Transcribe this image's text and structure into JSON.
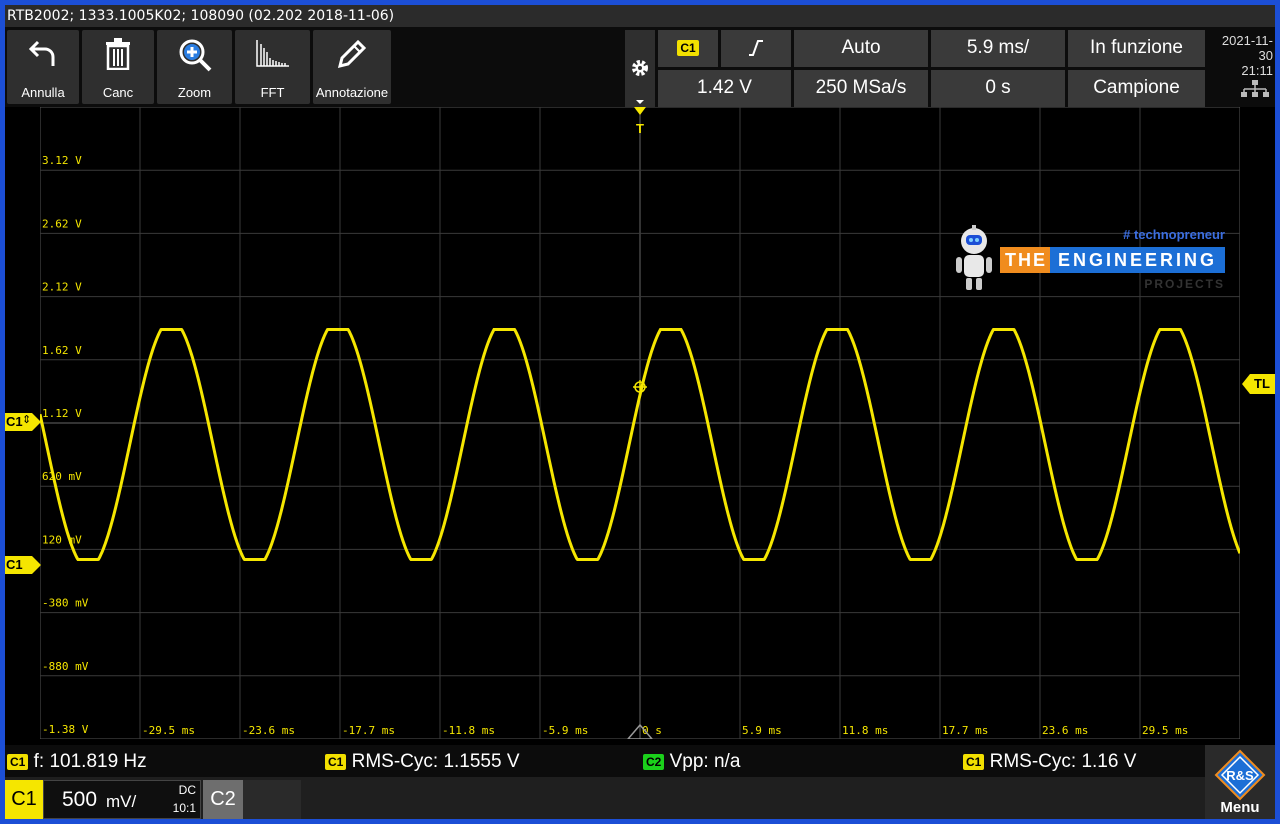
{
  "title": "RTB2002; 1333.1005K02; 108090 (02.202 2018-11-06)",
  "toolbar": {
    "undo": "Annulla",
    "delete": "Canc",
    "zoom": "Zoom",
    "fft": "FFT",
    "annotation": "Annotazione"
  },
  "trigger": {
    "source": "C1",
    "slope_icon": "rising-edge-icon",
    "mode": "Auto",
    "timebase": "5.9 ms/",
    "run_state": "In funzione",
    "level": "1.42 V",
    "sample_rate": "250 MSa/s",
    "position": "0 s",
    "acquisition": "Campione"
  },
  "datetime": {
    "date": "2021-11-30",
    "time": "21:11"
  },
  "watermark": {
    "tag": "# technopreneur",
    "word1": "THE",
    "word2": "ENGINEERING",
    "word3": "PROJECTS"
  },
  "markers": {
    "trigger_top": "T",
    "trigger_level": "TL",
    "channel_offset": "C1",
    "channel_ground": "C1"
  },
  "colors": {
    "trace": "#f5e600",
    "grid": "#3a3a3a",
    "accent_blue": "#1c4fd6",
    "ch2": "#1bd11b"
  },
  "chart_data": {
    "type": "line",
    "series": [
      {
        "values": "sine",
        "frequency_hz": 101.819,
        "vmin": 0.04,
        "vmax": 1.86
      }
    ],
    "x_ticks": [
      "-29.5 ms",
      "-23.6 ms",
      "-17.7 ms",
      "-11.8 ms",
      "-5.9 ms",
      "0 s",
      "5.9 ms",
      "11.8 ms",
      "17.7 ms",
      "23.6 ms",
      "29.5 ms"
    ],
    "y_ticks": [
      "3.12 V",
      "2.62 V",
      "2.12 V",
      "1.62 V",
      "1.12 V",
      "620 mV",
      "120 mV",
      "-380 mV",
      "-880 mV",
      "-1.38 V"
    ],
    "xlim": [
      -35.4,
      35.4
    ],
    "ylim": [
      -1.38,
      3.62
    ],
    "grid": true
  },
  "measurements": [
    {
      "ch": "C1",
      "text": "f: 101.819 Hz"
    },
    {
      "ch": "C1",
      "text": "RMS-Cyc: 1.1555 V"
    },
    {
      "ch": "C2",
      "text": "Vpp: n/a"
    },
    {
      "ch": "C1",
      "text": "RMS-Cyc: 1.16 V"
    }
  ],
  "channels": {
    "c1_label": "C1",
    "c1_scale": "500",
    "c1_unit": "mV/",
    "c1_coupling": "DC",
    "c1_probe": "10:1",
    "c2_label": "C2"
  },
  "menu": {
    "label": "Menu",
    "logo": "R&S"
  }
}
